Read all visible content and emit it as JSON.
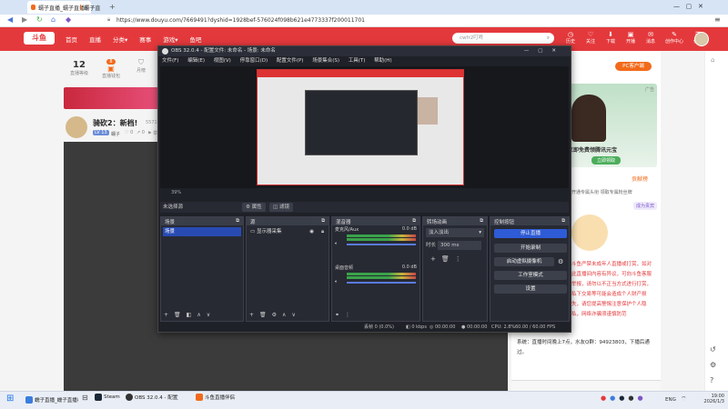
{
  "browser": {
    "tabs": [
      {
        "label": "蠕子直播_蠕子直播视频在线"
      },
      {
        "label": "蠕子直播_蠕子直播视频在线"
      }
    ],
    "new_tab": "+",
    "url": "https://www.douyu.com/7669491?dyshid=1928bef-576024f098b621e4773337f200011701"
  },
  "site": {
    "logo": "斗鱼",
    "nav": [
      "首页",
      "直播",
      "分类▾",
      "赛事",
      "游戏▾",
      "鱼吧"
    ],
    "search_placeholder": "cwfr2叮咚",
    "header_icons": [
      "历史",
      "关注",
      "下载",
      "开播",
      "消息",
      "创作中心",
      "任务"
    ],
    "anchor_level": "12",
    "anchor_level_label": "直播等级",
    "anchor_badge": "8",
    "anchor_badge_label": "直播钱包",
    "anchor_badge2_label": "月榜",
    "room_title": "骑砍2：新档!",
    "room_number": "5571",
    "room_tag": "LV 13",
    "room_owner": "蠕子",
    "room_likes": "0",
    "room_share": "0",
    "room_report": "举报",
    "pc_client": "PC客户端",
    "ad_label": "广告",
    "ad_text": "立即免费领腾讯元宝",
    "ad_cta": "立即领取",
    "rank_tab": "贡献榜",
    "rank_note": "开通专属头衔 领取专属粉丝牌",
    "rank_link": "成为贵宾",
    "chat_notice": "斗鱼严禁未成年人直播或打赏，如对此直播间内容有异议，可向斗鱼客服举报，请勿以不正当方式进行打赏，私下交易等可能会造成个人财产损失，请您提高警惕注意保护个人隐私，网络诈骗须谨慎防范",
    "chat_system": "系统：直播时间晚上7点，水友Q群：94923803，下播后通过。"
  },
  "obs": {
    "title": "OBS 32.0.4 - 配置文件: 未命名 - 场景: 未命名",
    "menu": [
      "文件(F)",
      "编辑(E)",
      "视图(V)",
      "停靠窗口(D)",
      "配置文件(P)",
      "场景集合(S)",
      "工具(T)",
      "帮助(H)"
    ],
    "zoom_text": "39%",
    "no_source": "未选择源",
    "properties": "属性",
    "filters": "滤镜",
    "docks": {
      "scenes": "场景",
      "sources": "源",
      "mixer": "混音器",
      "transitions": "转场动画",
      "controls": "控制按钮"
    },
    "scene_item": "场景",
    "source_item": "显示器采集",
    "mixer_tracks": [
      {
        "name": "麦克风/Aux",
        "db": "0.0 dB"
      },
      {
        "name": "桌面音频",
        "db": "0.0 dB"
      }
    ],
    "transition_type": "淡入淡出",
    "duration_label": "时长",
    "duration_value": "300 ms",
    "controls": [
      "停止直播",
      "开始录制",
      "启动虚拟摄像机",
      "工作室模式",
      "设置"
    ],
    "status": {
      "dropped": "丢帧 0 (0.0%)",
      "kbps": "0 kbps",
      "live_time": "00:00:00",
      "rec_time": "00:00:00",
      "cpu": "CPU: 2.8%",
      "fps": "60.00 / 60.00 FPS"
    }
  },
  "taskbar": {
    "items": [
      "蠕子直播_蠕子直播视频在线",
      "Steam",
      "OBS 32.0.4 - 配置文件: 未",
      "斗鱼直播伴侣"
    ],
    "lang": "ENG",
    "time": "19:00",
    "date": "2026/1/3"
  }
}
